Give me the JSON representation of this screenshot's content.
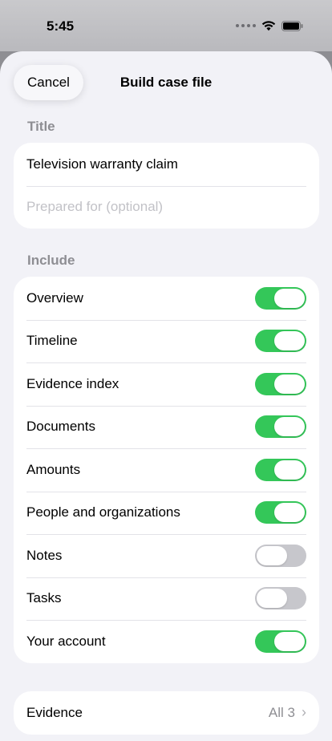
{
  "status": {
    "time": "5:45"
  },
  "sheet": {
    "cancel_label": "Cancel",
    "title": "Build case file"
  },
  "title_section": {
    "label": "Title",
    "title_value": "Television warranty claim",
    "prepared_for_placeholder": "Prepared for (optional)"
  },
  "include_section": {
    "label": "Include",
    "items": [
      {
        "label": "Overview",
        "on": true
      },
      {
        "label": "Timeline",
        "on": true
      },
      {
        "label": "Evidence index",
        "on": true
      },
      {
        "label": "Documents",
        "on": true
      },
      {
        "label": "Amounts",
        "on": true
      },
      {
        "label": "People and organizations",
        "on": true
      },
      {
        "label": "Notes",
        "on": false
      },
      {
        "label": "Tasks",
        "on": false
      },
      {
        "label": "Your account",
        "on": true
      }
    ]
  },
  "evidence_row": {
    "label": "Evidence",
    "value": "All 3"
  },
  "colors": {
    "toggle_on": "#34c759",
    "toggle_off": "#c7c7cc",
    "sheet_bg": "#f2f2f7"
  }
}
